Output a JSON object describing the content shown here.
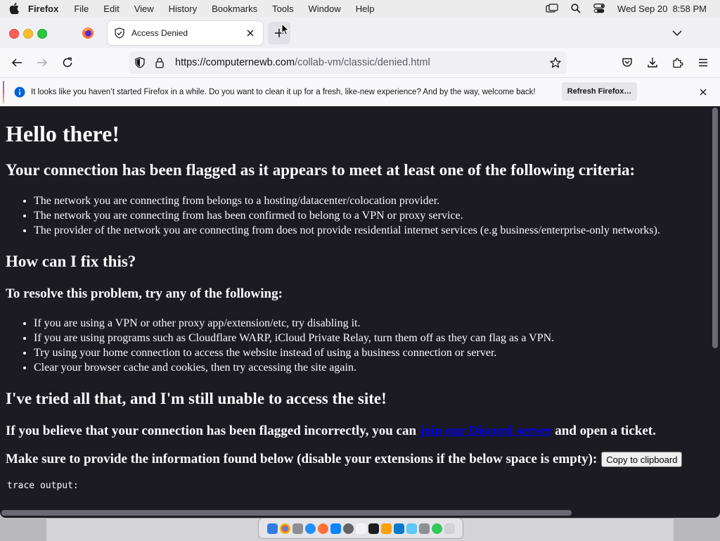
{
  "menubar": {
    "app_name": "Firefox",
    "items": [
      "File",
      "Edit",
      "View",
      "History",
      "Bookmarks",
      "Tools",
      "Window",
      "Help"
    ],
    "datetime": "Wed Sep 20  8:58 PM"
  },
  "tab": {
    "title": "Access Denied"
  },
  "urlbar": {
    "url_host": "https://computernewb.com",
    "url_path": "/collab-vm/classic/denied.html"
  },
  "notification": {
    "text": "It looks like you haven’t started Firefox in a while. Do you want to clean it up for a fresh, like-new experience? And by the way, welcome back!",
    "button_label": "Refresh Firefox…"
  },
  "page": {
    "heading": "Hello there!",
    "criteria_heading": "Your connection has been flagged as it appears to meet at least one of the following criteria:",
    "criteria": [
      "The network you are connecting from belongs to a hosting/datacenter/colocation provider.",
      "The network you are connecting from has been confirmed to belong to a VPN or proxy service.",
      "The provider of the network you are connecting from does not provide residential internet services (e.g business/enterprise-only networks)."
    ],
    "fix_heading": "How can I fix this?",
    "resolve_heading": "To resolve this problem, try any of the following:",
    "resolve_steps": [
      "If you are using a VPN or other proxy app/extension/etc, try disabling it.",
      "If you are using programs such as Cloudflare WARP, iCloud Private Relay, turn them off as they can flag as a VPN.",
      "Try using your home connection to access the website instead of using a business connection or server.",
      "Clear your browser cache and cookies, then try accessing the site again."
    ],
    "tried_heading": "I've tried all that, and I'm still unable to access the site!",
    "believe_prefix": "If you believe that your connection has been flagged incorrectly, you can",
    "discord_link": "join our Discord server",
    "believe_suffix": "and open a ticket.",
    "provide_text": "Make sure to provide the information found below (disable your extensions if the below space is empty):",
    "copy_button": "Copy to clipboard",
    "trace_label": "trace output:"
  },
  "colors": {
    "page_background": "#1c1b22",
    "page_text": "#fbfbfe",
    "link": "#0000ee"
  }
}
